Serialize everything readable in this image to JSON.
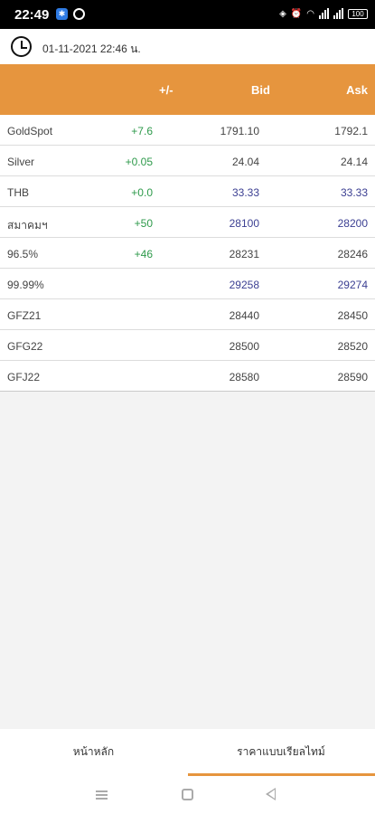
{
  "status_bar": {
    "time": "22:49",
    "battery": "100"
  },
  "timestamp": "01-11-2021 22:46 น.",
  "table_header": {
    "name": "",
    "change": "+/-",
    "bid": "Bid",
    "ask": "Ask"
  },
  "rows": [
    {
      "name": "GoldSpot",
      "change": "+7.6",
      "bid": "1791.10",
      "ask": "1792.1"
    },
    {
      "name": "Silver",
      "change": "+0.05",
      "bid": "24.04",
      "ask": "24.14"
    },
    {
      "name": "THB",
      "change": "+0.0",
      "bid": "33.33",
      "ask": "33.33"
    },
    {
      "name": "สมาคมฯ",
      "change": "+50",
      "bid": "28100",
      "ask": "28200"
    },
    {
      "name": "96.5%",
      "change": "+46",
      "bid": "28231",
      "ask": "28246"
    },
    {
      "name": "99.99%",
      "change": "",
      "bid": "29258",
      "ask": "29274"
    },
    {
      "name": "GFZ21",
      "change": "",
      "bid": "28440",
      "ask": "28450"
    },
    {
      "name": "GFG22",
      "change": "",
      "bid": "28500",
      "ask": "28520"
    },
    {
      "name": "GFJ22",
      "change": "",
      "bid": "28580",
      "ask": "28590"
    }
  ],
  "tabs": {
    "home": "หน้าหลัก",
    "realtime": "ราคาแบบเรียลไทม์"
  },
  "colors": {
    "accent": "#e6953e",
    "positive": "#2e9a4b",
    "highlight_value": "#3b3f92"
  }
}
